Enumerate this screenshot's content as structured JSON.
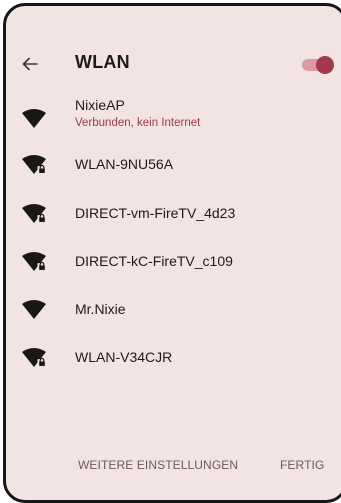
{
  "header": {
    "title": "WLAN",
    "wlan_enabled": true
  },
  "networks": [
    {
      "name": "NixieAP",
      "status": "Verbunden, kein Internet",
      "secured": false
    },
    {
      "name": "WLAN-9NU56A",
      "secured": true
    },
    {
      "name": "DIRECT-vm-FireTV_4d23",
      "secured": true
    },
    {
      "name": "DIRECT-kC-FireTV_c109",
      "secured": true
    },
    {
      "name": "Mr.Nixie",
      "secured": false
    },
    {
      "name": "WLAN-V34CJR",
      "secured": true
    }
  ],
  "footer": {
    "more_settings_label": "WEITERE EINSTELLUNGEN",
    "done_label": "FERTIG"
  },
  "colors": {
    "background": "#f3e4e4",
    "accent": "#a23a4c",
    "status_text": "#9a3a4a"
  },
  "icons": {
    "back": "arrow-left-icon",
    "wifi": "wifi-signal-icon",
    "lock": "lock-icon"
  }
}
